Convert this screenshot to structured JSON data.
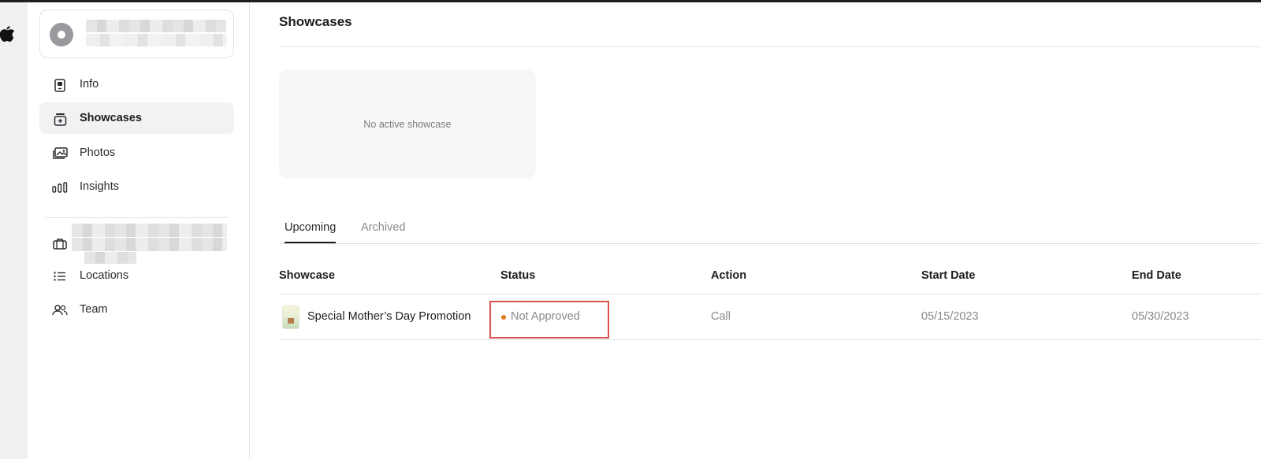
{
  "sidebar": {
    "items": [
      {
        "label": "Info",
        "icon": "phone-card-icon",
        "active": false
      },
      {
        "label": "Showcases",
        "icon": "showcase-plus-icon",
        "active": true
      },
      {
        "label": "Photos",
        "icon": "photos-icon",
        "active": false
      },
      {
        "label": "Insights",
        "icon": "bar-chart-icon",
        "active": false
      }
    ],
    "business_items": [
      {
        "label": "Locations",
        "icon": "list-icon"
      },
      {
        "label": "Team",
        "icon": "people-icon"
      }
    ]
  },
  "main": {
    "title": "Showcases",
    "empty_state": "No active showcase",
    "tabs": [
      {
        "label": "Upcoming",
        "active": true
      },
      {
        "label": "Archived",
        "active": false
      }
    ],
    "table": {
      "headers": [
        "Showcase",
        "Status",
        "Action",
        "Start Date",
        "End Date"
      ],
      "rows": [
        {
          "showcase": "Special Mother’s Day Promotion",
          "status": "Not Approved",
          "action": "Call",
          "start_date": "05/15/2023",
          "end_date": "05/30/2023"
        }
      ]
    }
  },
  "colors": {
    "status_dot": "#e07b1a",
    "highlight_box": "#d9534f",
    "active_nav_bg": "#f2f2f4"
  }
}
